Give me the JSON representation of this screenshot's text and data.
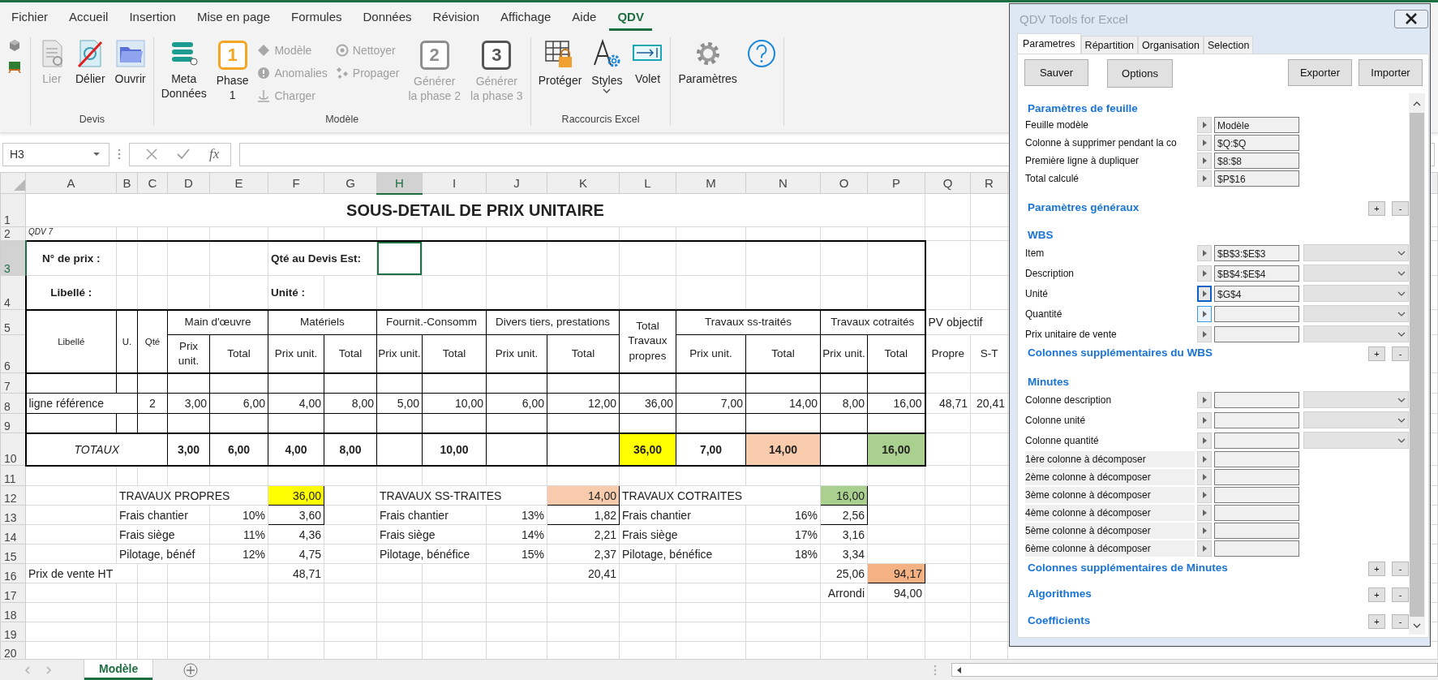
{
  "menu_tabs": [
    {
      "label": "Fichier",
      "selected": false
    },
    {
      "label": "Accueil",
      "selected": false
    },
    {
      "label": "Insertion",
      "selected": false
    },
    {
      "label": "Mise en page",
      "selected": false
    },
    {
      "label": "Formules",
      "selected": false
    },
    {
      "label": "Données",
      "selected": false
    },
    {
      "label": "Révision",
      "selected": false
    },
    {
      "label": "Affichage",
      "selected": false
    },
    {
      "label": "Aide",
      "selected": false
    },
    {
      "label": "QDV",
      "selected": true
    }
  ],
  "ribbon": {
    "groups": [
      {
        "label": "Devis",
        "buttons": [
          {
            "lines": [
              "Lier"
            ],
            "disabled": true
          },
          {
            "lines": [
              "Délier"
            ],
            "disabled": false
          },
          {
            "lines": [
              "Ouvrir"
            ],
            "disabled": false
          }
        ]
      },
      {
        "label": "Modèle",
        "buttons": [
          {
            "lines": [
              "Meta",
              "Données"
            ],
            "disabled": false
          },
          {
            "lines": [
              "Phase",
              "1"
            ],
            "badge": "1",
            "disabled": false
          },
          {
            "lines": [
              "Modèle"
            ],
            "disabled": true
          },
          {
            "lines": [
              "Anomalies"
            ],
            "disabled": true
          },
          {
            "lines": [
              "Charger"
            ],
            "disabled": true
          },
          {
            "lines": [
              "Nettoyer"
            ],
            "disabled": true
          },
          {
            "lines": [
              "Propager"
            ],
            "disabled": true
          },
          {
            "lines": [
              "Générer",
              "la phase 2"
            ],
            "badge": "2",
            "disabled": true
          },
          {
            "lines": [
              "Générer",
              "la phase 3"
            ],
            "badge": "3",
            "disabled": true
          }
        ]
      },
      {
        "label": "Raccourcis Excel",
        "buttons": [
          {
            "lines": [
              "Protéger"
            ],
            "disabled": false
          },
          {
            "lines": [
              "Styles"
            ],
            "disabled": false
          },
          {
            "lines": [
              "Volet"
            ],
            "disabled": false
          }
        ]
      },
      {
        "buttons": [
          {
            "lines": [
              "Paramètres"
            ],
            "disabled": false
          }
        ]
      }
    ]
  },
  "formula_bar": {
    "name_box": "H3",
    "function_label": "fx"
  },
  "sheet": {
    "columns": [
      {
        "label": "A",
        "selected": false
      },
      {
        "label": "B",
        "selected": false
      },
      {
        "label": "C",
        "selected": false
      },
      {
        "label": "D",
        "selected": false
      },
      {
        "label": "E",
        "selected": false
      },
      {
        "label": "F",
        "selected": false
      },
      {
        "label": "G",
        "selected": false
      },
      {
        "label": "H",
        "selected": true
      },
      {
        "label": "I",
        "selected": false
      },
      {
        "label": "J",
        "selected": false
      },
      {
        "label": "K",
        "selected": false
      },
      {
        "label": "L",
        "selected": false
      },
      {
        "label": "M",
        "selected": false
      },
      {
        "label": "N",
        "selected": false
      },
      {
        "label": "O",
        "selected": false
      },
      {
        "label": "P",
        "selected": false
      },
      {
        "label": "Q",
        "selected": false
      },
      {
        "label": "R",
        "selected": false
      }
    ],
    "rows": [
      {
        "header": "1",
        "selected": false,
        "cells": [
          {
            "text": "SOUS-DETAIL DE PRIX UNITAIRE",
            "kind": "title"
          }
        ]
      },
      {
        "header": "2",
        "selected": false,
        "cells": [
          {
            "text": "QDV 7",
            "kind": "note"
          }
        ]
      },
      {
        "header": "3",
        "selected": true,
        "cells": [
          {
            "text": "N° de prix :",
            "kind": "label"
          },
          {
            "text": "Qté au Devis Est:",
            "kind": "label-left"
          }
        ]
      },
      {
        "header": "4",
        "selected": false,
        "cells": [
          {
            "text": "Libellé :",
            "kind": "label"
          },
          {
            "text": "Unité :",
            "kind": "label-left"
          }
        ]
      },
      {
        "header": "5",
        "selected": false,
        "cells": [
          {
            "text": "Libellé",
            "kind": "header-small"
          },
          {
            "text": "U.",
            "kind": "header-small"
          },
          {
            "text": "Qté",
            "kind": "header-small"
          },
          {
            "text": "Main d'œuvre",
            "kind": "header"
          },
          {
            "text": "Matériels",
            "kind": "header"
          },
          {
            "text": "Fournit.-Consomm",
            "kind": "header"
          },
          {
            "text": "Divers tiers, prestations",
            "kind": "header"
          },
          {
            "text": "Total Travaux propres",
            "kind": "header"
          },
          {
            "text": "Travaux ss-traités",
            "kind": "header"
          },
          {
            "text": "Travaux cotraités",
            "kind": "header"
          },
          {
            "text": "PV objectif",
            "kind": "text"
          }
        ]
      },
      {
        "header": "6",
        "selected": false,
        "cells": [
          {
            "text": "Prix unit.",
            "kind": "header"
          },
          {
            "text": "Total",
            "kind": "header"
          },
          {
            "text": "Prix unit.",
            "kind": "header"
          },
          {
            "text": "Total",
            "kind": "header"
          },
          {
            "text": "Prix unit.",
            "kind": "header"
          },
          {
            "text": "Total",
            "kind": "header"
          },
          {
            "text": "Prix unit.",
            "kind": "header"
          },
          {
            "text": "Total",
            "kind": "header"
          },
          {
            "text": "Prix unit.",
            "kind": "header"
          },
          {
            "text": "Total",
            "kind": "header"
          },
          {
            "text": "Prix unit.",
            "kind": "header"
          },
          {
            "text": "Total",
            "kind": "header"
          },
          {
            "text": "Propre",
            "kind": "header"
          },
          {
            "text": "S-T",
            "kind": "header"
          }
        ]
      },
      {
        "header": "7",
        "selected": false
      },
      {
        "header": "8",
        "selected": false,
        "cells": [
          {
            "text": "ligne référence",
            "kind": "text"
          },
          {
            "text": "2",
            "kind": "center"
          },
          {
            "text": "3,00",
            "kind": "number"
          },
          {
            "text": "6,00",
            "kind": "number"
          },
          {
            "text": "4,00",
            "kind": "number"
          },
          {
            "text": "8,00",
            "kind": "number"
          },
          {
            "text": "5,00",
            "kind": "number"
          },
          {
            "text": "10,00",
            "kind": "number"
          },
          {
            "text": "6,00",
            "kind": "number"
          },
          {
            "text": "12,00",
            "kind": "number"
          },
          {
            "text": "36,00",
            "kind": "number"
          },
          {
            "text": "7,00",
            "kind": "number"
          },
          {
            "text": "14,00",
            "kind": "number"
          },
          {
            "text": "8,00",
            "kind": "number"
          },
          {
            "text": "16,00",
            "kind": "number"
          },
          {
            "text": "48,71",
            "kind": "number"
          },
          {
            "text": "20,41",
            "kind": "number"
          }
        ]
      },
      {
        "header": "9",
        "selected": false
      },
      {
        "header": "10",
        "selected": false,
        "cells": [
          {
            "text": "TOTAUX",
            "kind": "italic"
          },
          {
            "text": "3,00",
            "kind": "total"
          },
          {
            "text": "6,00",
            "kind": "total"
          },
          {
            "text": "4,00",
            "kind": "total"
          },
          {
            "text": "8,00",
            "kind": "total"
          },
          {
            "text": "10,00",
            "kind": "total"
          },
          {
            "text": "36,00",
            "kind": "total",
            "color": "#ffff00"
          },
          {
            "text": "7,00",
            "kind": "total"
          },
          {
            "text": "14,00",
            "kind": "total",
            "color": "#f8cbad"
          },
          {
            "text": "16,00",
            "kind": "total",
            "color": "#a9d08e"
          }
        ]
      },
      {
        "header": "11",
        "selected": false
      },
      {
        "header": "12",
        "selected": false,
        "cells": [
          {
            "text": "TRAVAUX PROPRES",
            "kind": "text"
          },
          {
            "text": "36,00",
            "kind": "number",
            "color": "#ffff00"
          },
          {
            "text": "TRAVAUX SS-TRAITES",
            "kind": "text"
          },
          {
            "text": "14,00",
            "kind": "number",
            "color": "#f8cbad"
          },
          {
            "text": "TRAVAUX COTRAITES",
            "kind": "text"
          },
          {
            "text": "16,00",
            "kind": "number",
            "color": "#a9d08e"
          }
        ]
      },
      {
        "header": "13",
        "selected": false,
        "cells": [
          {
            "text": "Frais chantier",
            "kind": "text"
          },
          {
            "text": "10%",
            "kind": "number"
          },
          {
            "text": "3,60",
            "kind": "number"
          },
          {
            "text": "Frais chantier",
            "kind": "text"
          },
          {
            "text": "13%",
            "kind": "number"
          },
          {
            "text": "1,82",
            "kind": "number"
          },
          {
            "text": "Frais chantier",
            "kind": "text"
          },
          {
            "text": "16%",
            "kind": "number"
          },
          {
            "text": "2,56",
            "kind": "number"
          }
        ]
      },
      {
        "header": "14",
        "selected": false,
        "cells": [
          {
            "text": "Frais siège",
            "kind": "text"
          },
          {
            "text": "11%",
            "kind": "number"
          },
          {
            "text": "4,36",
            "kind": "number"
          },
          {
            "text": "Frais siège",
            "kind": "text"
          },
          {
            "text": "14%",
            "kind": "number"
          },
          {
            "text": "2,21",
            "kind": "number"
          },
          {
            "text": "Frais siège",
            "kind": "text"
          },
          {
            "text": "17%",
            "kind": "number"
          },
          {
            "text": "3,16",
            "kind": "number"
          }
        ]
      },
      {
        "header": "15",
        "selected": false,
        "cells": [
          {
            "text": "Pilotage, bénéf",
            "kind": "text"
          },
          {
            "text": "12%",
            "kind": "number"
          },
          {
            "text": "4,75",
            "kind": "number"
          },
          {
            "text": "Pilotage, bénéfice",
            "kind": "text"
          },
          {
            "text": "15%",
            "kind": "number"
          },
          {
            "text": "2,37",
            "kind": "number"
          },
          {
            "text": "Pilotage, bénéfice",
            "kind": "text"
          },
          {
            "text": "18%",
            "kind": "number"
          },
          {
            "text": "3,34",
            "kind": "number"
          }
        ]
      },
      {
        "header": "16",
        "selected": false,
        "cells": [
          {
            "text": "Prix de vente HT",
            "kind": "text"
          },
          {
            "text": "48,71",
            "kind": "number"
          },
          {
            "text": "20,41",
            "kind": "number"
          },
          {
            "text": "25,06",
            "kind": "number"
          },
          {
            "text": "94,17",
            "kind": "number",
            "color": "#f4b183"
          }
        ]
      },
      {
        "header": "17",
        "selected": false,
        "cells": [
          {
            "text": "Arrondi",
            "kind": "number"
          },
          {
            "text": "94,00",
            "kind": "number"
          }
        ]
      },
      {
        "header": "18",
        "selected": false
      },
      {
        "header": "19",
        "selected": false
      },
      {
        "header": "20",
        "selected": false
      }
    ]
  },
  "sheet_tabs": [
    {
      "label": "Modèle",
      "selected": true
    }
  ],
  "panel": {
    "title": "QDV Tools for Excel",
    "tabs": [
      {
        "label": "Parametres",
        "selected": true
      },
      {
        "label": "Répartition",
        "selected": false
      },
      {
        "label": "Organisation",
        "selected": false
      },
      {
        "label": "Selection",
        "selected": false
      }
    ],
    "buttons": [
      "Sauver",
      "Options",
      "Exporter",
      "Importer"
    ],
    "sections": [
      {
        "title": "Paramètres de feuille",
        "fields": [
          {
            "label": "Feuille modèle",
            "value": "Modèle",
            "kind": "cell",
            "focused": false,
            "hovered": false
          },
          {
            "label": "Colonne à supprimer pendant la co",
            "value": "$Q:$Q",
            "kind": "cell",
            "focused": false,
            "hovered": false
          },
          {
            "label": "Première ligne à dupliquer",
            "value": "$8:$8",
            "kind": "cell",
            "focused": false,
            "hovered": false
          },
          {
            "label": "Total calculé",
            "value": "$P$16",
            "kind": "cell",
            "focused": false,
            "hovered": false
          }
        ]
      },
      {
        "title": "Paramètres généraux",
        "toggles": [
          "+",
          "-"
        ]
      },
      {
        "title": "WBS",
        "fields": [
          {
            "label": "Item",
            "value": "$B$3:$E$3",
            "kind": "cell-list",
            "focused": false,
            "hovered": false
          },
          {
            "label": "Description",
            "value": "$B$4:$E$4",
            "kind": "cell-list",
            "focused": false,
            "hovered": false
          },
          {
            "label": "Unité",
            "value": "$G$4",
            "kind": "cell-list",
            "focused": true,
            "hovered": false
          },
          {
            "label": "Quantité",
            "kind": "cell-list",
            "focused": false,
            "hovered": true
          },
          {
            "label": "Prix unitaire de vente",
            "kind": "cell-list",
            "focused": false,
            "hovered": false
          }
        ]
      },
      {
        "title": "Colonnes supplémentaires du WBS",
        "toggles": [
          "+",
          "-"
        ]
      },
      {
        "title": "Minutes",
        "fields": [
          {
            "label": "Colonne description",
            "kind": "cell-list",
            "focused": false,
            "hovered": false
          },
          {
            "label": "Colonne unité",
            "kind": "cell-list",
            "focused": false,
            "hovered": false
          },
          {
            "label": "Colonne quantité",
            "kind": "cell-list",
            "focused": false,
            "hovered": false
          },
          {
            "label": "1ère colonne à décomposer",
            "kind": "cell-shaded",
            "focused": false,
            "hovered": false
          },
          {
            "label": "2ème colonne à décomposer",
            "kind": "cell-shaded",
            "focused": false,
            "hovered": false
          },
          {
            "label": "3ème colonne à décomposer",
            "kind": "cell-shaded",
            "focused": false,
            "hovered": false
          },
          {
            "label": "4ème colonne à décomposer",
            "kind": "cell-shaded",
            "focused": false,
            "hovered": false
          },
          {
            "label": "5ème colonne à décomposer",
            "kind": "cell-shaded",
            "focused": false,
            "hovered": false
          },
          {
            "label": "6ème colonne à décomposer",
            "kind": "cell-shaded",
            "focused": false,
            "hovered": false
          }
        ]
      },
      {
        "title": "Colonnes supplémentaires de Minutes",
        "toggles": [
          "+",
          "-"
        ]
      },
      {
        "title": "Algorithmes",
        "toggles": [
          "+",
          "-"
        ]
      },
      {
        "title": "Coefficients",
        "toggles": [
          "+",
          "-"
        ]
      }
    ]
  }
}
